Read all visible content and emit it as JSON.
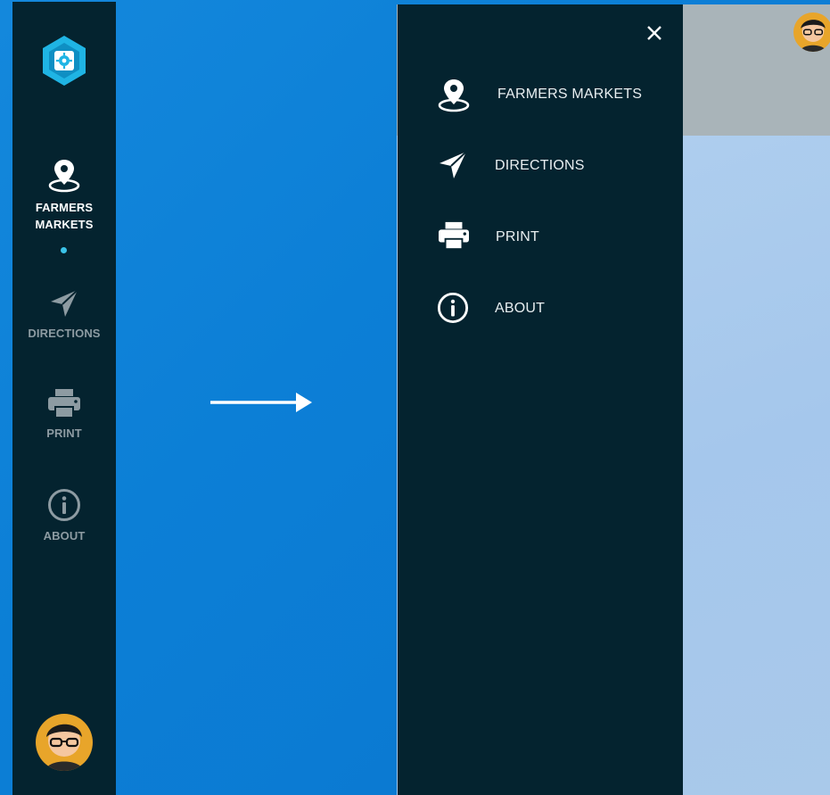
{
  "rail": {
    "items": [
      {
        "label_line1": "FARMERS",
        "label_line2": "MARKETS",
        "icon": "map-pin-icon",
        "active": true
      },
      {
        "label": "DIRECTIONS",
        "icon": "navigation-arrow-icon"
      },
      {
        "label": "PRINT",
        "icon": "printer-icon"
      },
      {
        "label": "ABOUT",
        "icon": "info-icon"
      }
    ]
  },
  "drawer": {
    "items": [
      {
        "label": "FARMERS MARKETS",
        "icon": "map-pin-icon"
      },
      {
        "label": "DIRECTIONS",
        "icon": "navigation-arrow-icon"
      },
      {
        "label": "PRINT",
        "icon": "printer-icon"
      },
      {
        "label": "ABOUT",
        "icon": "info-icon"
      }
    ]
  },
  "colors": {
    "background_blue": "#0c7fd6",
    "panel_dark": "#04232f",
    "accent_cyan": "#3bc3e8",
    "header_gray": "#a9b4b9"
  }
}
